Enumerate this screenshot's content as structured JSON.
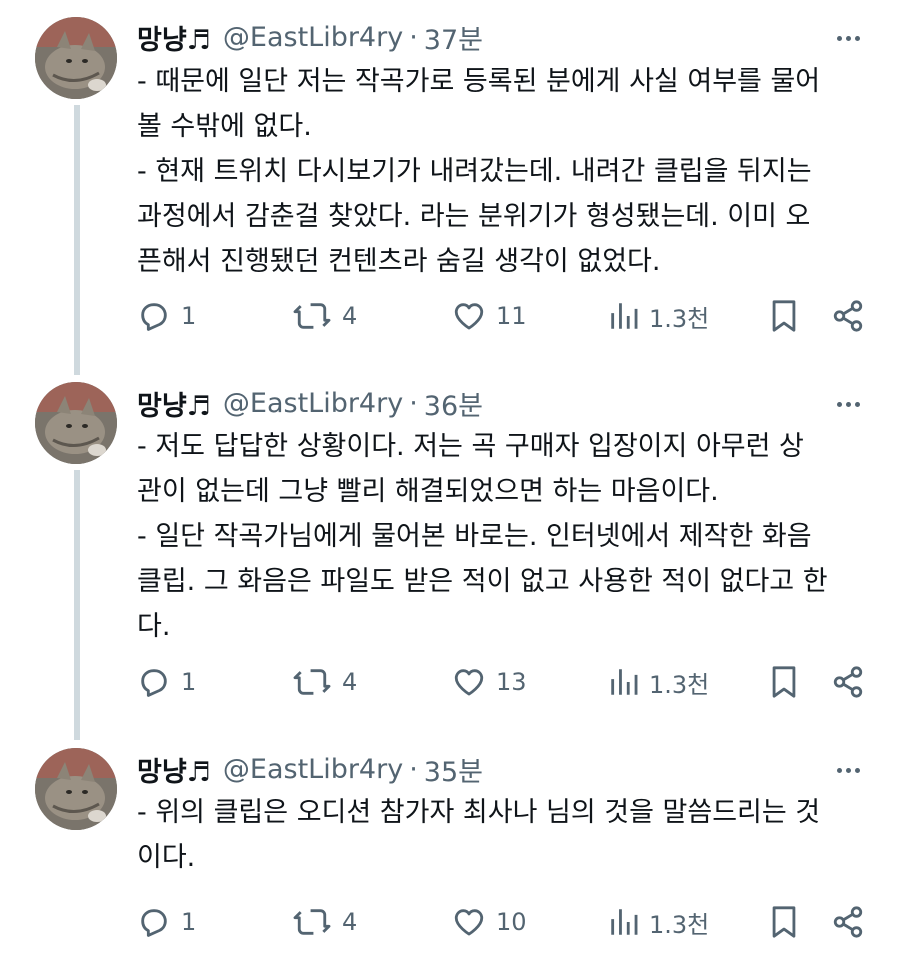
{
  "tweets": [
    {
      "name": "망냥♬",
      "handle": "@EastLibr4ry",
      "separator": "·",
      "time": "37분",
      "lines": [
        "- 때문에 일단 저는 작곡가로 등록된 분에게 사실 여부를 물어",
        "볼 수밖에 없다.",
        "- 현재 트위치 다시보기가 내려갔는데. 내려간 클립을 뒤지는",
        "과정에서 감춘걸 찾았다. 라는 분위기가 형성됐는데. 이미 오",
        "픈해서 진행됐던 컨텐츠라 숨길 생각이 없었다."
      ],
      "replies": "1",
      "retweets": "4",
      "likes": "11",
      "views": "1.3천"
    },
    {
      "name": "망냥♬",
      "handle": "@EastLibr4ry",
      "separator": "·",
      "time": "36분",
      "lines": [
        "- 저도 답답한 상황이다. 저는 곡 구매자 입장이지 아무런 상",
        "관이 없는데 그냥 빨리 해결되었으면 하는 마음이다.",
        "- 일단 작곡가님에게 물어본 바로는. 인터넷에서 제작한 화음",
        "클립. 그 화음은 파일도 받은 적이 없고 사용한 적이 없다고 한",
        "다."
      ],
      "replies": "1",
      "retweets": "4",
      "likes": "13",
      "views": "1.3천"
    },
    {
      "name": "망냥♬",
      "handle": "@EastLibr4ry",
      "separator": "·",
      "time": "35분",
      "lines": [
        "- 위의 클립은 오디션 참가자 최사나 님의 것을 말씀드리는 것",
        "이다."
      ],
      "replies": "1",
      "retweets": "4",
      "likes": "10",
      "views": "1.3천"
    }
  ],
  "icons": {
    "reply": "reply-icon",
    "retweet": "retweet-icon",
    "like": "heart-icon",
    "views": "views-chart-icon",
    "bookmark": "bookmark-icon",
    "share": "share-icon",
    "more": "more-dots-icon"
  },
  "colors": {
    "text": "#0f1419",
    "secondary": "#536471",
    "thread_line": "#cfd9de"
  }
}
